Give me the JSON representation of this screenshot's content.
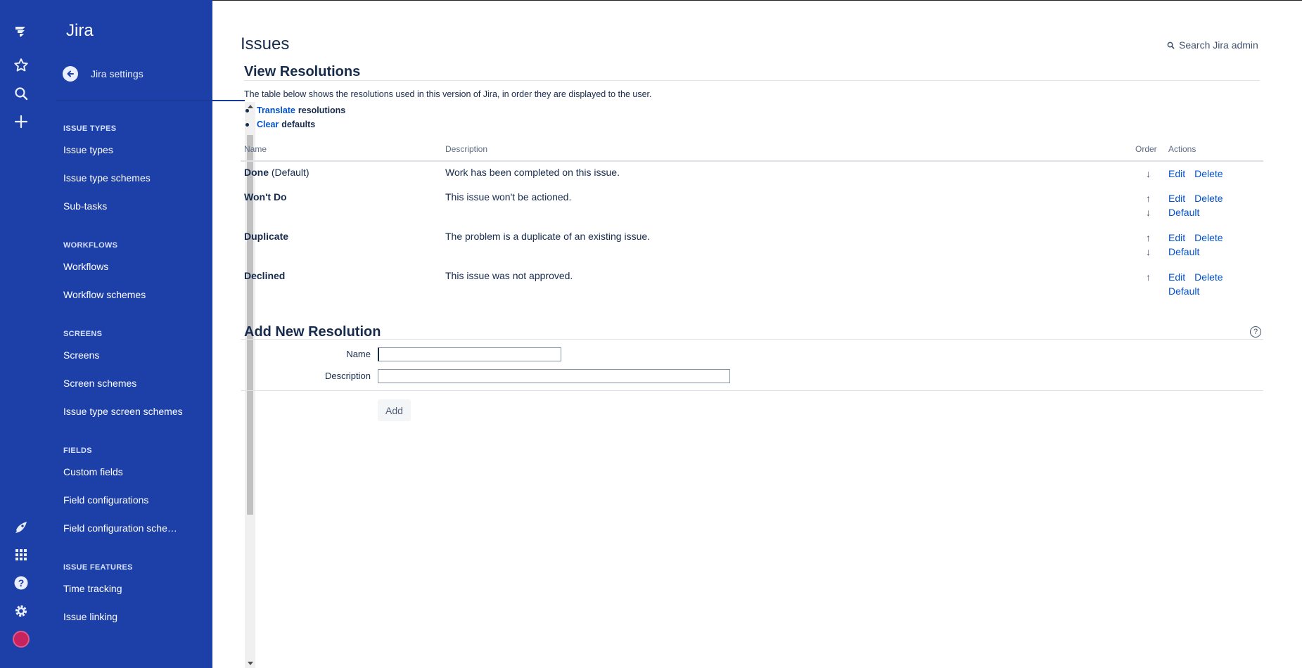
{
  "colors": {
    "sidebar_bg": "#1d40a8",
    "link": "#0052cc",
    "text": "#172b4d"
  },
  "rail": {
    "top_icons": [
      "jira-logo-icon",
      "star-icon",
      "search-icon",
      "plus-icon"
    ],
    "bottom_icons": [
      "rocket-icon",
      "app-grid-icon",
      "help-icon",
      "gear-icon",
      "avatar"
    ]
  },
  "sidebar": {
    "title": "Jira",
    "back_label": "Jira settings",
    "sections": [
      {
        "heading": "ISSUE TYPES",
        "items": [
          "Issue types",
          "Issue type schemes",
          "Sub-tasks"
        ]
      },
      {
        "heading": "WORKFLOWS",
        "items": [
          "Workflows",
          "Workflow schemes"
        ]
      },
      {
        "heading": "SCREENS",
        "items": [
          "Screens",
          "Screen schemes",
          "Issue type screen schemes"
        ]
      },
      {
        "heading": "FIELDS",
        "items": [
          "Custom fields",
          "Field configurations",
          "Field configuration sche…"
        ]
      },
      {
        "heading": "ISSUE FEATURES",
        "items": [
          "Time tracking",
          "Issue linking"
        ]
      }
    ]
  },
  "header": {
    "title": "Issues",
    "search_admin": "Search Jira admin"
  },
  "view": {
    "heading": "View Resolutions",
    "intro": "The table below shows the resolutions used in this version of Jira, in order they are displayed to the user.",
    "bullets": [
      {
        "link": "Translate",
        "text": "resolutions"
      },
      {
        "link": "Clear",
        "text": "defaults"
      }
    ],
    "columns": [
      "Name",
      "Description",
      "Order",
      "Actions"
    ],
    "rows": [
      {
        "name": "Done",
        "suffix": "(Default)",
        "description": "Work has been completed on this issue.",
        "order": [
          "down"
        ],
        "actions": [
          [
            "Edit",
            "Delete"
          ]
        ]
      },
      {
        "name": "Won't Do",
        "suffix": "",
        "description": "This issue won't be actioned.",
        "order": [
          "up",
          "down"
        ],
        "actions": [
          [
            "Edit",
            "Delete"
          ],
          [
            "Default"
          ]
        ]
      },
      {
        "name": "Duplicate",
        "suffix": "",
        "description": "The problem is a duplicate of an existing issue.",
        "order": [
          "up",
          "down"
        ],
        "actions": [
          [
            "Edit",
            "Delete"
          ],
          [
            "Default"
          ]
        ]
      },
      {
        "name": "Declined",
        "suffix": "",
        "description": "This issue was not approved.",
        "order": [
          "up"
        ],
        "actions": [
          [
            "Edit",
            "Delete"
          ],
          [
            "Default"
          ]
        ]
      }
    ]
  },
  "add": {
    "heading": "Add New Resolution",
    "help": "?",
    "name_label": "Name",
    "description_label": "Description",
    "name_value": "",
    "description_value": "",
    "button": "Add"
  }
}
